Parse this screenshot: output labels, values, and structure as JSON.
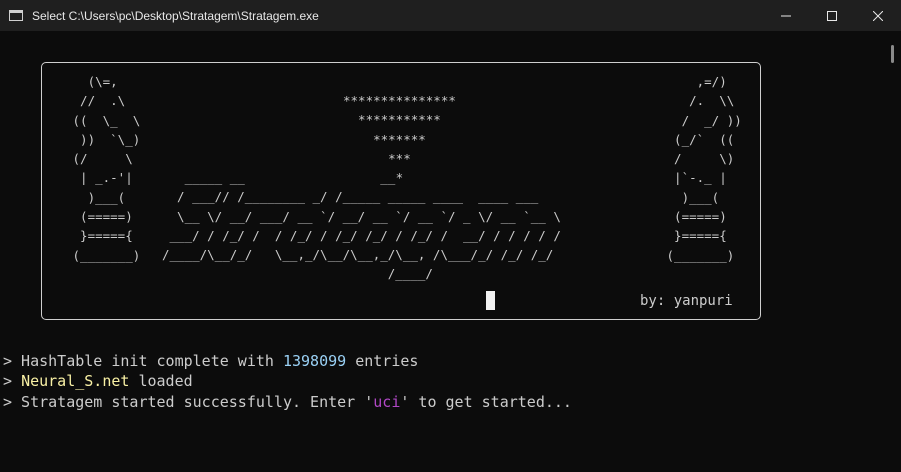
{
  "window": {
    "title": "Select C:\\Users\\pc\\Desktop\\Stratagem\\Stratagem.exe"
  },
  "banner": {
    "left_piece": "   (\\=,\n  //  .\\\n ((  \\_  \\\n  ))  `\\_)\n (/     \\\n  | _.-'|\n   )___(\n  (=====)\n  }====={\n (_______)",
    "right_piece": "     ,=/)\n    /.  \\\\\n   /  _/ ))\n  (_/`  ((\n  /     \\)\n  |`-._ |\n   )___(\n  (=====)\n  }====={\n (_______)",
    "stars": "***************\n  ***********\n    *******\n      ***\n       *",
    "logo": "   _____ __                  __\n  / ___// /________ _/ /_____ _____ ____  ____ ___\n  \\__ \\/ __/ ___/ __ `/ __/ __ `/ __ `/ _ \\/ __ `__ \\\n ___/ / /_/ /  / /_/ / /_/ /_/ / /_/ /  __/ / / / / /\n/____/\\__/_/   \\__,_/\\__/\\__,_/\\__, /\\___/_/ /_/ /_/\n                              /____/",
    "byline": "by: yanpuri"
  },
  "log": {
    "line1_prefix": "> HashTable init complete with ",
    "line1_number": "1398099",
    "line1_suffix": " entries",
    "line2_prefix": "> ",
    "line2_name": "Neural_S.net",
    "line2_suffix": " loaded",
    "line3_prefix": "> Stratagem started successfully. Enter '",
    "line3_cmd": "uci",
    "line3_suffix": "' to get started..."
  },
  "colors": {
    "background": "#0c0c0c",
    "text": "#cccccc",
    "number": "#9ad1f5",
    "filename": "#f9f1a5",
    "command": "#b148c6"
  },
  "icons": [
    "console-app-icon",
    "minimize-icon",
    "maximize-icon",
    "close-icon"
  ]
}
